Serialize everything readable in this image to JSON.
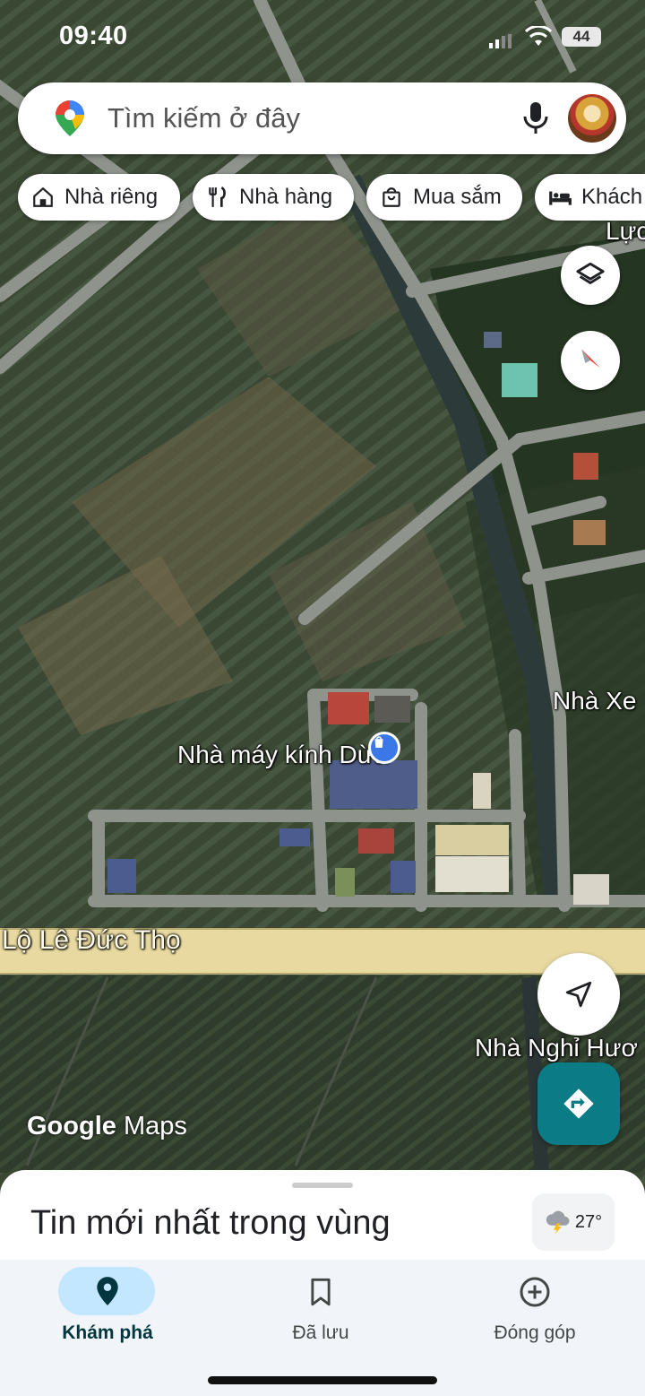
{
  "status_bar": {
    "time": "09:40",
    "battery": "44"
  },
  "search": {
    "placeholder": "Tìm kiếm ở đây"
  },
  "chips": [
    {
      "label": "Nhà riêng",
      "icon": "home-icon"
    },
    {
      "label": "Nhà hàng",
      "icon": "restaurant-icon"
    },
    {
      "label": "Mua sắm",
      "icon": "shopping-bag-icon"
    },
    {
      "label": "Khách",
      "icon": "hotel-bed-icon"
    }
  ],
  "map": {
    "place_labels": {
      "top_right": "Lực",
      "factory": "Nhà máy kính Dừa",
      "nha_xe": "Nhà Xe",
      "road": "Lộ Lê Đức Thọ",
      "guesthouse": "Nhà Nghỉ Hươ"
    },
    "attribution": {
      "brand": "Google",
      "product": "Maps"
    }
  },
  "sheet": {
    "title": "Tin mới nhất trong vùng",
    "weather": {
      "temperature": "27°",
      "icon": "thunderstorm-icon"
    }
  },
  "bottom_nav": {
    "items": [
      {
        "label": "Khám phá",
        "icon": "explore-pin-icon",
        "active": true
      },
      {
        "label": "Đã lưu",
        "icon": "bookmark-icon",
        "active": false
      },
      {
        "label": "Đóng góp",
        "icon": "add-circle-icon",
        "active": false
      }
    ]
  },
  "colors": {
    "accent": "#0b7c85",
    "nav_active_pill": "#c2e7ff",
    "active_icon": "#00363d"
  }
}
